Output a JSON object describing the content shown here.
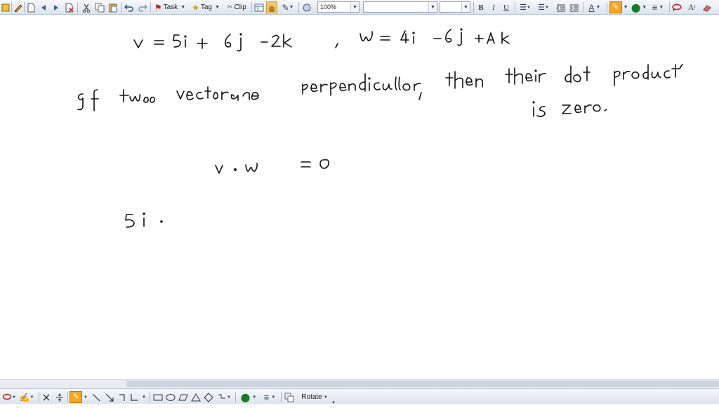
{
  "toolbar": {
    "task_label": "Task",
    "tag_label": "Tag",
    "clip_label": "Clip",
    "zoom_value": "100%",
    "font_name_value": "",
    "font_size_value": "",
    "bold_label": "B",
    "italic_label": "I",
    "underline_label": "U",
    "font_color_label": "A",
    "text_size_label": "A",
    "pen_color": "#f5a623",
    "highlight_color": "#e8c200"
  },
  "bottom_toolbar": {
    "rotate_label": "Rotate"
  },
  "handwriting": {
    "line1_v": "v = 5i + 6j − 2k",
    "line1_w": "w = 4i − 6j + Ak",
    "line2": "If two vectors are perpendicular, then their dot product",
    "line3": "is zero.",
    "line4": "v · w = 0",
    "line5": "5i ·"
  }
}
